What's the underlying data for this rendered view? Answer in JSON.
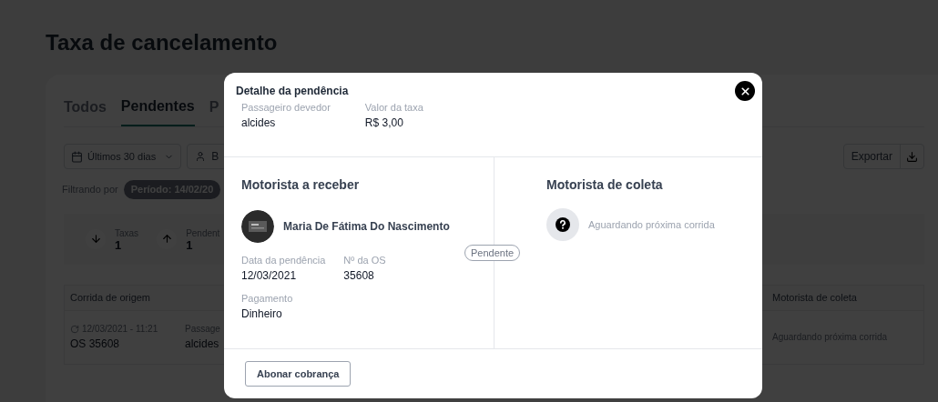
{
  "page": {
    "title": "Taxa de cancelamento",
    "tabs": [
      {
        "label": "Todos",
        "selected": false
      },
      {
        "label": "Pendentes",
        "selected": true
      },
      {
        "label": "P",
        "selected": false
      }
    ],
    "date_filter": "Últimos 30 dias",
    "user_filter": "B",
    "export_button": "Exportar",
    "filter_label": "Filtrando por",
    "filter_chip": "Período: 14/02/20",
    "stats": [
      {
        "label": "Taxas",
        "value": "1",
        "kind": "down"
      },
      {
        "label": "Pendent",
        "value": "1",
        "kind": "up"
      }
    ],
    "table": {
      "columns": [
        "Corrida de origem",
        "Motorista de coleta"
      ],
      "row": {
        "datetime": "12/03/2021 - 11:21",
        "os": "OS 35608",
        "passenger_label": "Passage",
        "passenger": "alcides",
        "collector": "Aguardando próxima corrida"
      }
    }
  },
  "modal": {
    "title": "Detalhe da pendência",
    "summary": [
      {
        "label": "Passageiro devedor",
        "value": "alcides"
      },
      {
        "label": "Valor da taxa",
        "value": "R$ 3,00"
      }
    ],
    "receiver": {
      "title": "Motorista a receber",
      "name": "Maria De Fátima Do Nascimento",
      "fields": [
        {
          "label": "Data da pendência",
          "value": "12/03/2021"
        },
        {
          "label": "Nº da OS",
          "value": "35608"
        }
      ],
      "payment": {
        "label": "Pagamento",
        "value": "Dinheiro"
      }
    },
    "status": "Pendente",
    "collector": {
      "title": "Motorista de coleta",
      "text": "Aguardando próxima corrida"
    },
    "action_button": "Abonar cobrança"
  }
}
